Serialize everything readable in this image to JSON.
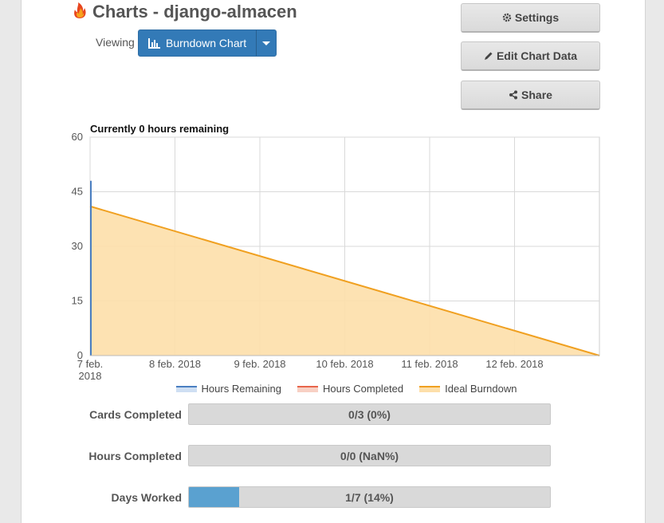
{
  "header": {
    "title": "Charts - django-almacen",
    "logo_icon": "flame-icon",
    "viewing_label": "Viewing",
    "chart_select_label": "Burndown Chart",
    "chart_select_icon": "bar-chart-icon"
  },
  "buttons": {
    "settings": "Settings",
    "edit_chart_data": "Edit Chart Data",
    "share": "Share"
  },
  "chart_data": {
    "type": "area",
    "title": "Currently 0 hours remaining",
    "xlabel": "",
    "ylabel": "",
    "ylim": [
      0,
      60
    ],
    "yticks": [
      "0",
      "15",
      "30",
      "45",
      "60"
    ],
    "x_tick_labels": [
      "7 feb. 2018",
      "8 feb. 2018",
      "9 feb. 2018",
      "10 feb. 2018",
      "11 feb. 2018",
      "12 feb. 2018"
    ],
    "grid": true,
    "legend_position": "bottom",
    "series": [
      {
        "name": "Hours Remaining",
        "color": "#4a7fc1",
        "x": [
          "7 feb. 2018",
          "7 feb. 2018"
        ],
        "values": [
          48,
          0
        ]
      },
      {
        "name": "Hours Completed",
        "color": "#e8654a",
        "x": [],
        "values": []
      },
      {
        "name": "Ideal Burndown",
        "color": "#f0a020",
        "fill": "#fddfaa",
        "x": [
          "7 feb. 2018",
          "13 feb. 2018"
        ],
        "values": [
          41,
          0
        ]
      }
    ]
  },
  "stats": [
    {
      "label": "Cards Completed",
      "text": "0/3 (0%)",
      "fraction": 0
    },
    {
      "label": "Hours Completed",
      "text": "0/0 (NaN%)",
      "fraction": 0
    },
    {
      "label": "Days Worked",
      "text": "1/7 (14%)",
      "fraction": 0.14
    }
  ]
}
